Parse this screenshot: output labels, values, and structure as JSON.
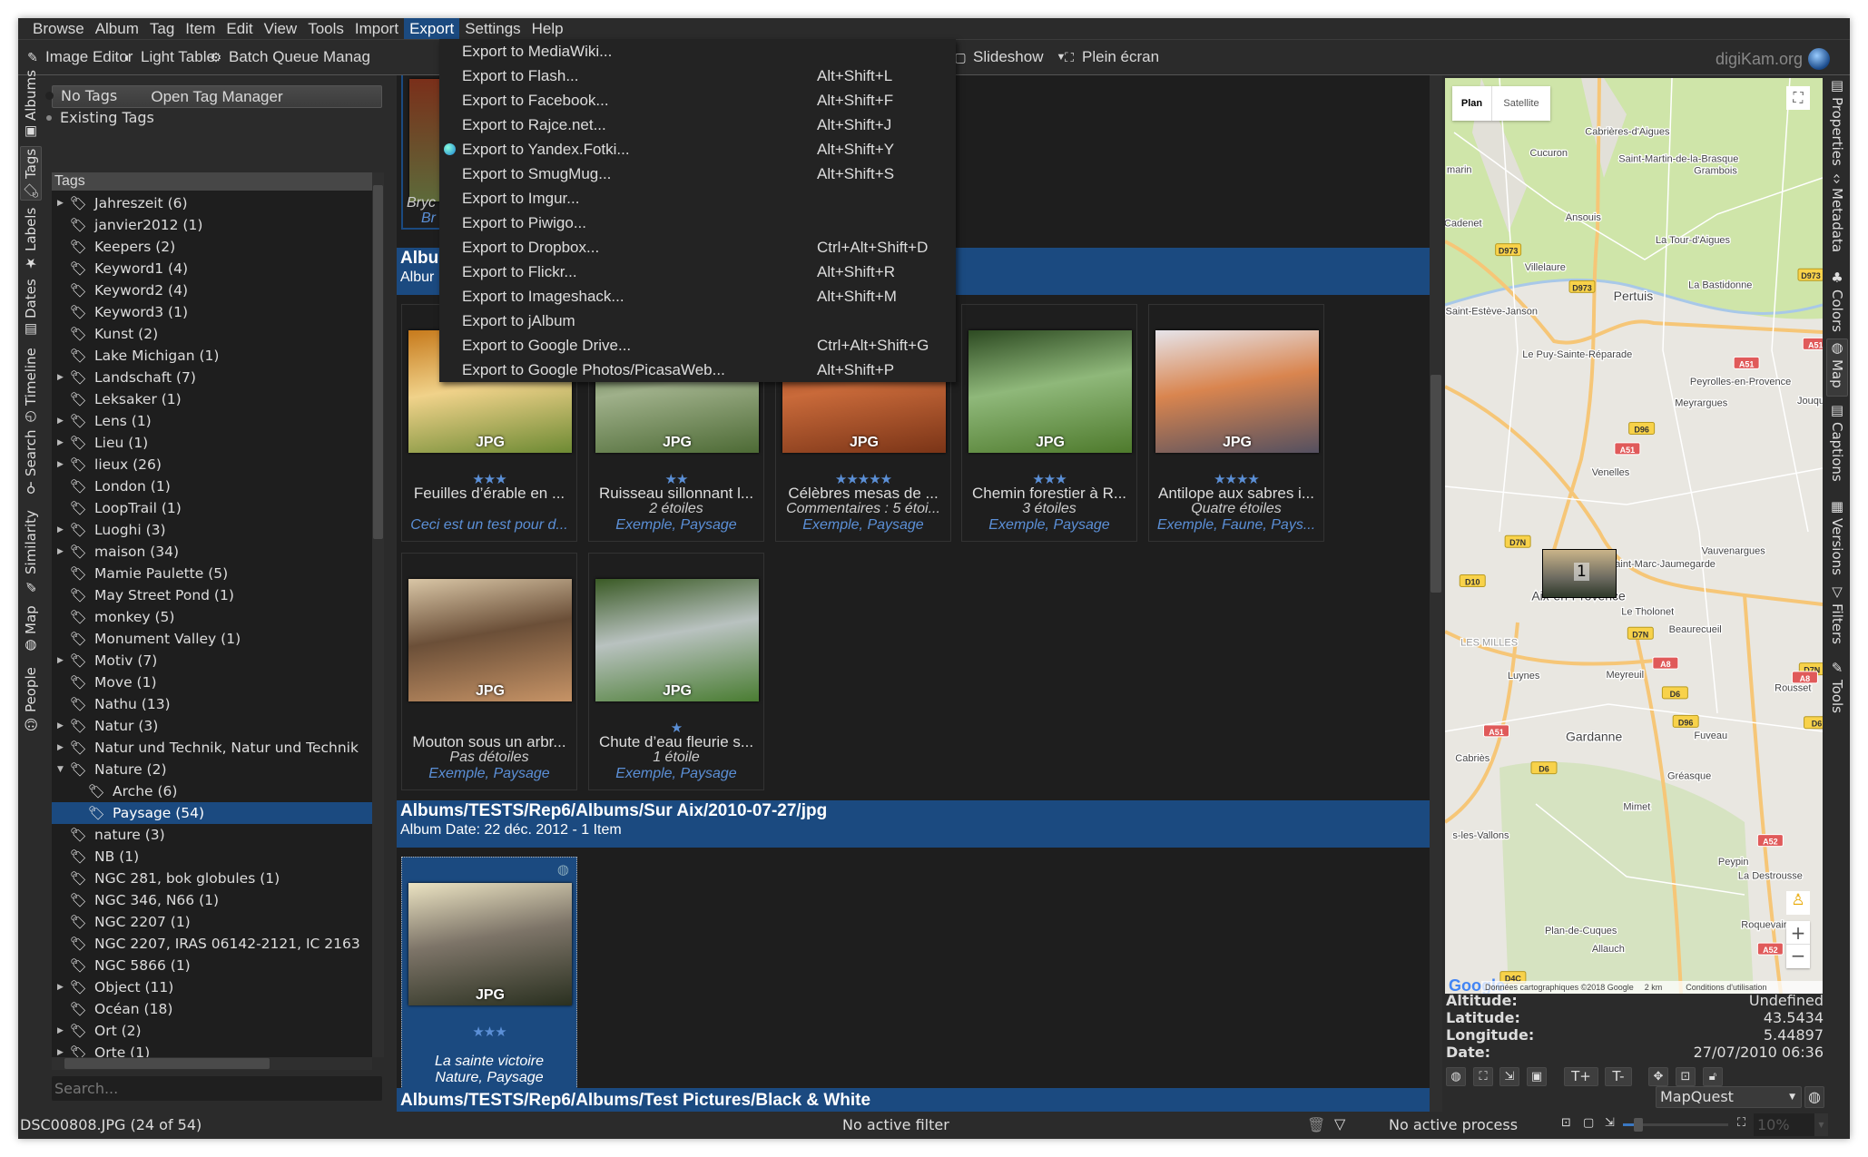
{
  "menubar": [
    "Browse",
    "Album",
    "Tag",
    "Item",
    "Edit",
    "View",
    "Tools",
    "Import",
    "Export",
    "Settings",
    "Help"
  ],
  "menubar_active": "Export",
  "toolbar": {
    "image_editor": "Image Editor",
    "light_table": "Light Table",
    "batch_queue": "Batch Queue Manag",
    "slideshow": "Slideshow",
    "fullscreen": "Plein écran",
    "brand": "digiKam.org"
  },
  "export_menu": [
    {
      "label": "Export to MediaWiki...",
      "shortcut": ""
    },
    {
      "label": "Export to Flash...",
      "shortcut": "Alt+Shift+L"
    },
    {
      "label": "Export to Facebook...",
      "shortcut": "Alt+Shift+F"
    },
    {
      "label": "Export to Rajce.net...",
      "shortcut": "Alt+Shift+J"
    },
    {
      "label": "Export to Yandex.Fotki...",
      "shortcut": "Alt+Shift+Y",
      "icon": "globe-icon"
    },
    {
      "label": "Export to SmugMug...",
      "shortcut": "Alt+Shift+S"
    },
    {
      "label": "Export to Imgur...",
      "shortcut": ""
    },
    {
      "label": "Export to Piwigo...",
      "shortcut": ""
    },
    {
      "label": "Export to Dropbox...",
      "shortcut": "Ctrl+Alt+Shift+D"
    },
    {
      "label": "Export to Flickr...",
      "shortcut": "Alt+Shift+R"
    },
    {
      "label": "Export to Imageshack...",
      "shortcut": "Alt+Shift+M"
    },
    {
      "label": "Export to jAlbum",
      "shortcut": ""
    },
    {
      "label": "Export to Google Drive...",
      "shortcut": "Ctrl+Alt+Shift+G"
    },
    {
      "label": "Export to Google Photos/PicasaWeb...",
      "shortcut": "Alt+Shift+P"
    }
  ],
  "left_tabs": [
    "Albums",
    "Tags",
    "Labels",
    "Dates",
    "Timeline",
    "Search",
    "Similarity",
    "Map",
    "People"
  ],
  "left_tab_selected": "Tags",
  "right_tabs": [
    "Properties",
    "Metadata",
    "Colors",
    "Map",
    "Captions",
    "Versions",
    "Filters",
    "Tools"
  ],
  "right_tab_selected": "Map",
  "tags_panel": {
    "open_tag_manager": "Open Tag Manager",
    "no_tags": "No Tags",
    "existing_tags": "Existing Tags",
    "header": "Tags",
    "search_placeholder": "Search...",
    "items": [
      {
        "label": "Jahreszeit (6)",
        "expandable": true
      },
      {
        "label": "janvier2012 (1)"
      },
      {
        "label": "Keepers (2)"
      },
      {
        "label": "Keyword1 (4)"
      },
      {
        "label": "Keyword2 (4)"
      },
      {
        "label": "Keyword3 (1)"
      },
      {
        "label": "Kunst (2)"
      },
      {
        "label": "Lake Michigan (1)"
      },
      {
        "label": "Landschaft (7)",
        "expandable": true
      },
      {
        "label": "Leksaker (1)"
      },
      {
        "label": "Lens (1)",
        "expandable": true
      },
      {
        "label": "Lieu (1)",
        "expandable": true
      },
      {
        "label": "lieux (26)",
        "expandable": true
      },
      {
        "label": "London (1)"
      },
      {
        "label": "LoopTrail (1)"
      },
      {
        "label": "Luoghi (3)",
        "expandable": true
      },
      {
        "label": "maison (34)",
        "expandable": true
      },
      {
        "label": "Mamie Paulette (5)"
      },
      {
        "label": "May Street Pond (1)"
      },
      {
        "label": "monkey (5)"
      },
      {
        "label": "Monument Valley (1)"
      },
      {
        "label": "Motiv (7)",
        "expandable": true
      },
      {
        "label": "Move (1)"
      },
      {
        "label": "Nathu (13)"
      },
      {
        "label": "Natur (3)",
        "expandable": true
      },
      {
        "label": "Natur und Technik, Natur und Technik",
        "expandable": true
      },
      {
        "label": "Nature (2)",
        "expanded": true
      },
      {
        "label": "Arche (6)",
        "level": 1
      },
      {
        "label": "Paysage (54)",
        "level": 1,
        "selected": true
      },
      {
        "label": "nature (3)"
      },
      {
        "label": "NB (1)"
      },
      {
        "label": "NGC 281, bok globules (1)"
      },
      {
        "label": "NGC 346, N66 (1)"
      },
      {
        "label": "NGC 2207 (1)"
      },
      {
        "label": "NGC 2207, IRAS 06142-2121, IC 2163"
      },
      {
        "label": "NGC 5866 (1)"
      },
      {
        "label": "Object (11)",
        "expandable": true
      },
      {
        "label": "Océan (18)"
      },
      {
        "label": "Ort (2)",
        "expandable": true
      },
      {
        "label": "Orte (1)",
        "expandable": true
      }
    ]
  },
  "albums": {
    "top_partial": {
      "title": "Bryc",
      "tags": "Br"
    },
    "album1": {
      "title": "Albu",
      "subtitle": "Albur"
    },
    "cards": [
      {
        "stars": 3,
        "title": "Feuilles d’érable en ...",
        "subtitle": "",
        "tags": "Ceci est un test pour d...",
        "badge": "JPG",
        "colors": [
          "#c77a1c",
          "#f0d28a",
          "#6d8a33"
        ]
      },
      {
        "stars": 2,
        "title": "Ruisseau sillonnant l...",
        "subtitle": "2 étoiles",
        "tags": "Exemple, Paysage",
        "badge": "JPG",
        "colors": [
          "#3e5a2c",
          "#9fb08a",
          "#4d6a35"
        ]
      },
      {
        "stars": 5,
        "title": "Célèbres mesas de ...",
        "subtitle": "Commentaires : 5 étoi...",
        "tags": "Exemple, Paysage",
        "badge": "JPG",
        "colors": [
          "#8a3a1a",
          "#c96a3a",
          "#7a3417"
        ]
      },
      {
        "stars": 3,
        "title": "Chemin forestier à R...",
        "subtitle": "3 étoiles",
        "tags": "Exemple, Paysage",
        "badge": "JPG",
        "colors": [
          "#2d4a22",
          "#8fb87a",
          "#4e7a2c"
        ]
      },
      {
        "stars": 4,
        "title": "Antilope aux sabres i...",
        "subtitle": "Quatre étoiles",
        "tags": "Exemple, Faune, Pays...",
        "badge": "JPG",
        "colors": [
          "#e6e4ea",
          "#d9854f",
          "#545060"
        ]
      },
      {
        "stars": 0,
        "title": "Mouton sous un arbr...",
        "subtitle": "Pas détoiles",
        "tags": "Exemple, Paysage",
        "badge": "JPG",
        "colors": [
          "#d9c6a6",
          "#6b4f38",
          "#c69366"
        ]
      },
      {
        "stars": 1,
        "title": "Chute d’eau fleurie s...",
        "subtitle": "1 étoile",
        "tags": "Exemple, Paysage",
        "badge": "JPG",
        "colors": [
          "#3a5a25",
          "#b9c2c0",
          "#4a7d32"
        ]
      }
    ],
    "album2": {
      "title": "Albums/TESTS/Rep6/Albums/Sur Aix/2010-07-27/jpg",
      "subtitle": "Album Date: 22 déc. 2012 - 1 Item"
    },
    "selected_card": {
      "stars": 3,
      "subtitle": "La sainte victoire",
      "tags": "Nature, Paysage",
      "badge": "JPG",
      "colors": [
        "#ebe3c2",
        "#7d7468",
        "#2a3020"
      ]
    },
    "album3": {
      "title": "Albums/TESTS/Rep6/Albums/Test Pictures/Black & White"
    }
  },
  "map": {
    "type_plan": "Plan",
    "type_satellite": "Satellite",
    "marker_count": "1",
    "labels": [
      "Cabrières-d'Aigues",
      "Cucuron",
      "Saint-Martin-de-la-Brasque",
      "Grambois",
      "marin",
      "Cadenet",
      "Ansouis",
      "La Tour-d'Aigues",
      "Villelaure",
      "La Bastidonne",
      "Pertuis",
      "Saint-Estève-Janson",
      "Le Puy-Sainte-Réparade",
      "Peyrolles-en-Provence",
      "Meyrargues",
      "Jouqu",
      "Venelles",
      "Vauvenargues",
      "Saint-Marc-Jaumegarde",
      "Aix-en-Provence",
      "Le Tholonet",
      "Beaurecueil",
      "LES MILLES",
      "Luynes",
      "Meyreuil",
      "Rousset",
      "Gardanne",
      "Fuveau",
      "Cabriès",
      "Gréasque",
      "Mimet",
      "s-les-Vallons",
      "Peypin",
      "La Destrousse",
      "Roquevaire",
      "Plan-de-Cuques",
      "Allauch"
    ],
    "road_shields": [
      "D973",
      "D973",
      "D973",
      "A51",
      "A51",
      "D96",
      "A51",
      "D7N",
      "D10",
      "D7N",
      "A8",
      "D7N",
      "D6",
      "D96",
      "A8",
      "D6",
      "A51",
      "D6",
      "A52",
      "A52",
      "D4C"
    ],
    "attribution": "Données cartographiques ©2018 Google",
    "scale": "2 km",
    "terms": "Conditions d'utilisation",
    "google": "Google",
    "zoom_in": "+",
    "zoom_out": "−"
  },
  "geo": {
    "altitude_label": "Altitude",
    "altitude": "Undefined",
    "latitude_label": "Latitude",
    "latitude": "43.5434",
    "longitude_label": "Longitude",
    "longitude": "5.44897",
    "date_label": "Date",
    "date": "27/07/2010 06:36",
    "text_plus": "T+",
    "text_minus": "T-",
    "provider": "MapQuest"
  },
  "status": {
    "file": "DSC00808.JPG (24 of 54)",
    "filter": "No active filter",
    "process": "No active process",
    "zoom": "10%",
    "zoom_fraction": 0.1
  },
  "colors": {
    "accent": "#1b4a80",
    "rating": "#5b8fd6",
    "background": "#1e1e1e"
  }
}
